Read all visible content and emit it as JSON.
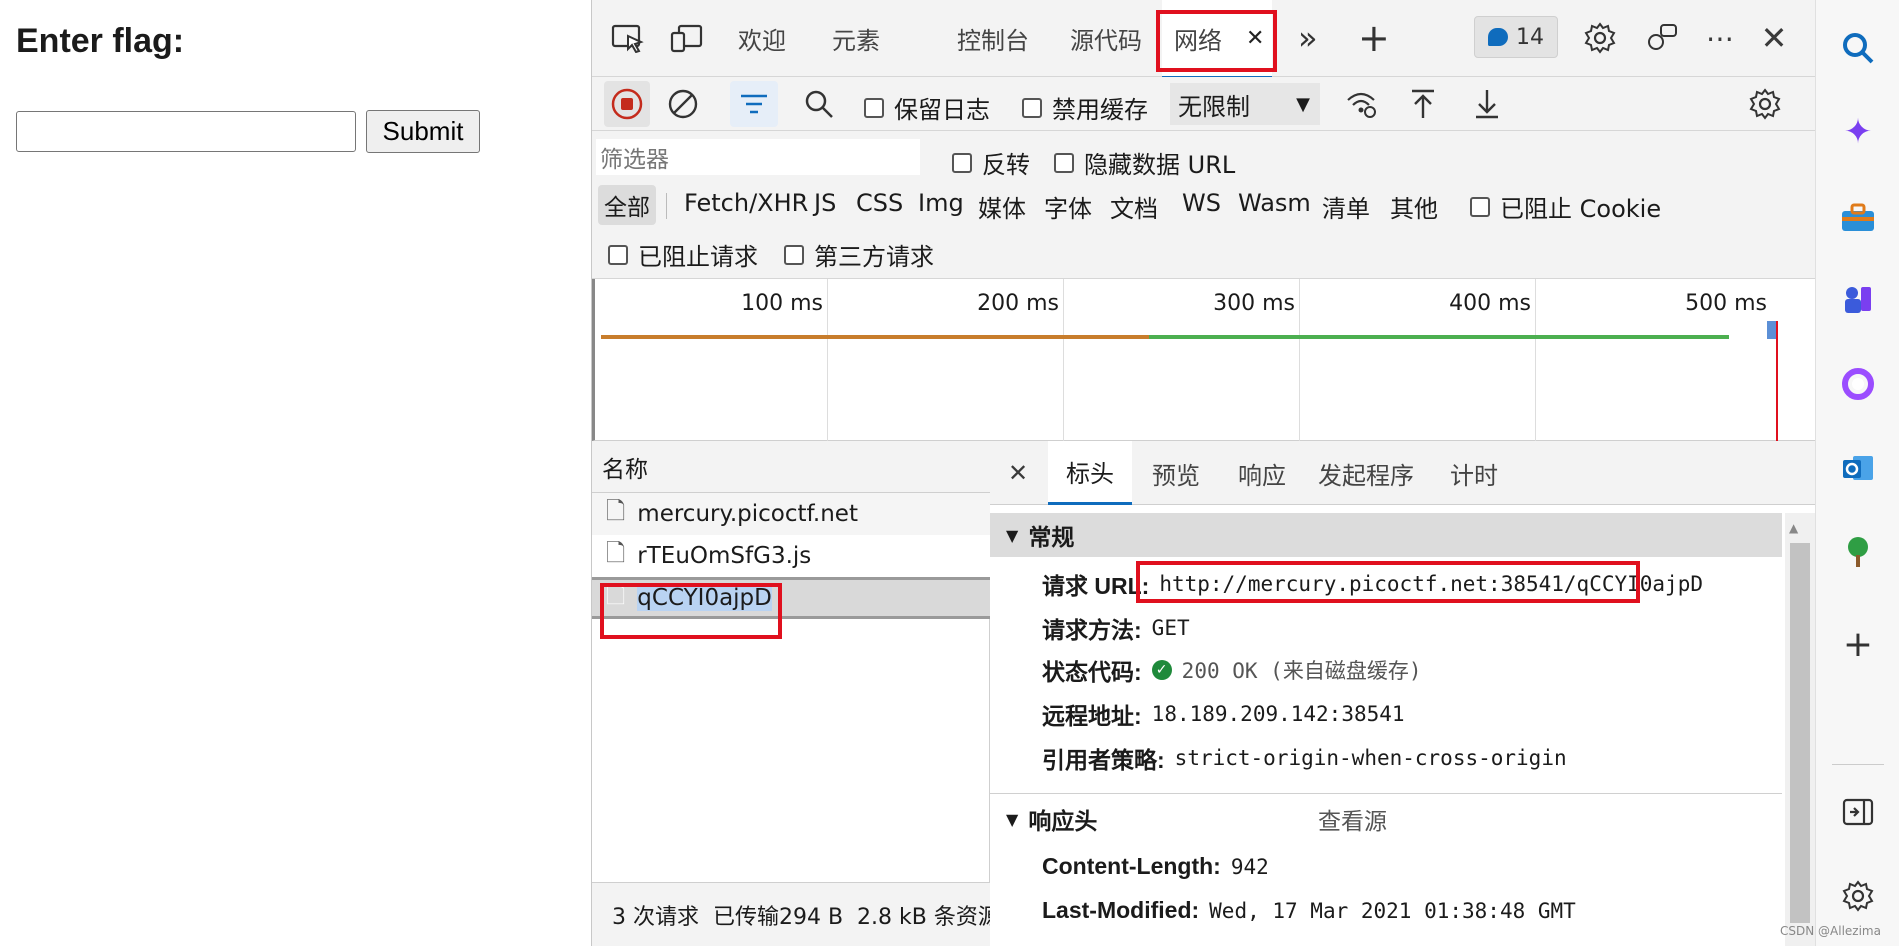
{
  "page": {
    "heading": "Enter flag:",
    "input_value": "",
    "submit_label": "Submit"
  },
  "devtools": {
    "tabs": {
      "welcome": "欢迎",
      "elements": "元素",
      "console": "控制台",
      "sources": "源代码",
      "network": "网络",
      "more": "»",
      "add": "+"
    },
    "issues_count": "14",
    "toolbar": {
      "preserve_log": "保留日志",
      "disable_cache": "禁用缓存",
      "throttling": "无限制"
    },
    "filter": {
      "placeholder": "筛选器",
      "invert": "反转",
      "hide_data_urls": "隐藏数据 URL"
    },
    "type_filters": [
      "全部",
      "Fetch/XHR",
      "JS",
      "CSS",
      "Img",
      "媒体",
      "字体",
      "文档",
      "WS",
      "Wasm",
      "清单",
      "其他"
    ],
    "blocked_cookies": "已阻止 Cookie",
    "blocked_requests": "已阻止请求",
    "third_party": "第三方请求",
    "timeline": {
      "ticks": [
        "100 ms",
        "200 ms",
        "300 ms",
        "400 ms",
        "500 ms"
      ]
    },
    "requests": {
      "header": "名称",
      "items": [
        "mercury.picoctf.net",
        "rTEuOmSfG3.js",
        "qCCYI0ajpD"
      ],
      "footer": "3 次请求  已传输294 B  2.8 kB 条资源"
    },
    "detail": {
      "tabs": [
        "标头",
        "预览",
        "响应",
        "发起程序",
        "计时"
      ],
      "general_title": "常规",
      "request_url_label": "请求 URL:",
      "request_url": "http://mercury.picoctf.net:38541/qCCYI0ajpD",
      "method_label": "请求方法:",
      "method": "GET",
      "status_label": "状态代码:",
      "status": "200 OK (来自磁盘缓存)",
      "remote_label": "远程地址:",
      "remote": "18.189.209.142:38541",
      "referrer_label": "引用者策略:",
      "referrer": "strict-origin-when-cross-origin",
      "response_headers_title": "响应头",
      "view_source": "查看源",
      "content_length_label": "Content-Length:",
      "content_length": "942",
      "last_modified_label": "Last-Modified:",
      "last_modified": "Wed, 17 Mar 2021 01:38:48 GMT"
    }
  },
  "watermark": "CSDN @Allezima",
  "colors": {
    "accent": "#0f6cbd",
    "highlight": "#e0101e",
    "status_ok": "#1f8a3b",
    "record": "#c42b1c"
  }
}
